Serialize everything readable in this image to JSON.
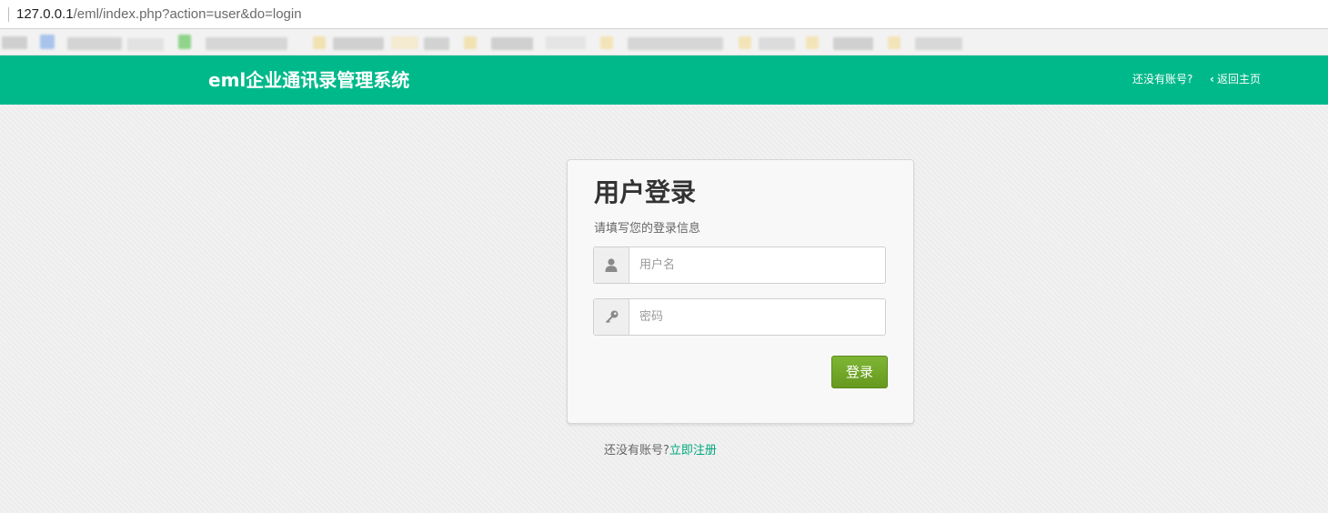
{
  "browser": {
    "url_host": "127.0.0.1",
    "url_path": "/eml/index.php?action=user&do=login"
  },
  "header": {
    "title": "eml企业通讯录管理系统",
    "nav_register": "还没有账号?",
    "nav_home": "返回主页",
    "accent_color": "#00b98a"
  },
  "login": {
    "title": "用户登录",
    "subtitle": "请填写您的登录信息",
    "username_placeholder": "用户名",
    "password_placeholder": "密码",
    "submit_label": "登录",
    "username_icon": "user-icon",
    "password_icon": "key-icon"
  },
  "footer": {
    "prompt": "还没有账号?",
    "register_link": "立即注册"
  }
}
